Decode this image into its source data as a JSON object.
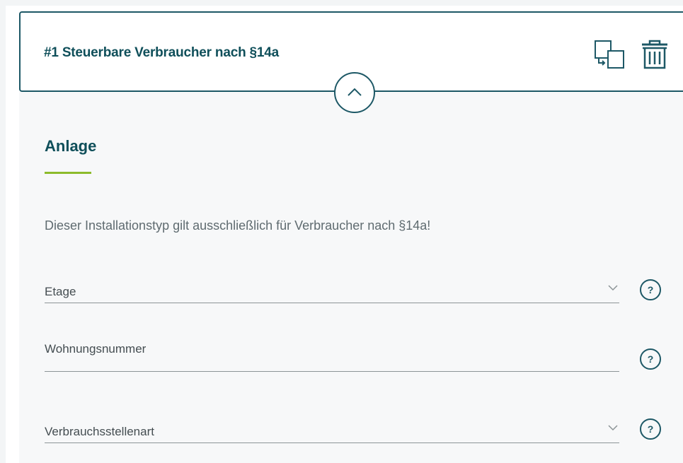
{
  "header": {
    "title": "#1 Steuerbare Verbraucher nach §14a",
    "copy_icon": "copy-icon",
    "delete_icon": "trash-icon",
    "collapse_icon": "chevron-up-icon"
  },
  "section": {
    "title": "Anlage",
    "info": "Dieser Installationstyp gilt ausschließlich für Verbraucher nach §14a!"
  },
  "fields": {
    "etage": {
      "label": "Etage",
      "type": "select",
      "help_glyph": "?"
    },
    "wohnungsnummer": {
      "label": "Wohnungsnummer",
      "type": "text",
      "help_glyph": "?"
    },
    "verbrauchsstellenart": {
      "label": "Verbrauchsstellenart",
      "type": "select",
      "help_glyph": "?"
    }
  },
  "colors": {
    "primary": "#1d5866",
    "title_text": "#0f4f5a",
    "accent_underline": "#8dbb2b",
    "muted_text": "#5f6b70"
  }
}
